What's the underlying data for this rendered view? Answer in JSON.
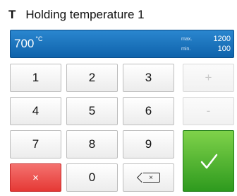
{
  "header": {
    "symbol": "T",
    "title": "Holding temperature 1"
  },
  "value_bar": {
    "value": "700",
    "unit": "°C",
    "max_label": "max.",
    "max_value": "1200",
    "min_label": "min.",
    "min_value": "100"
  },
  "keypad": {
    "keys": [
      "1",
      "2",
      "3",
      "+",
      "4",
      "5",
      "6",
      "-",
      "7",
      "8",
      "9",
      "0"
    ],
    "cancel_label": "×",
    "backspace_label": "×",
    "confirm_label": "✓"
  },
  "colors": {
    "value_bar": "#1a74bf",
    "cancel": "#e53935",
    "confirm": "#43a82a"
  }
}
